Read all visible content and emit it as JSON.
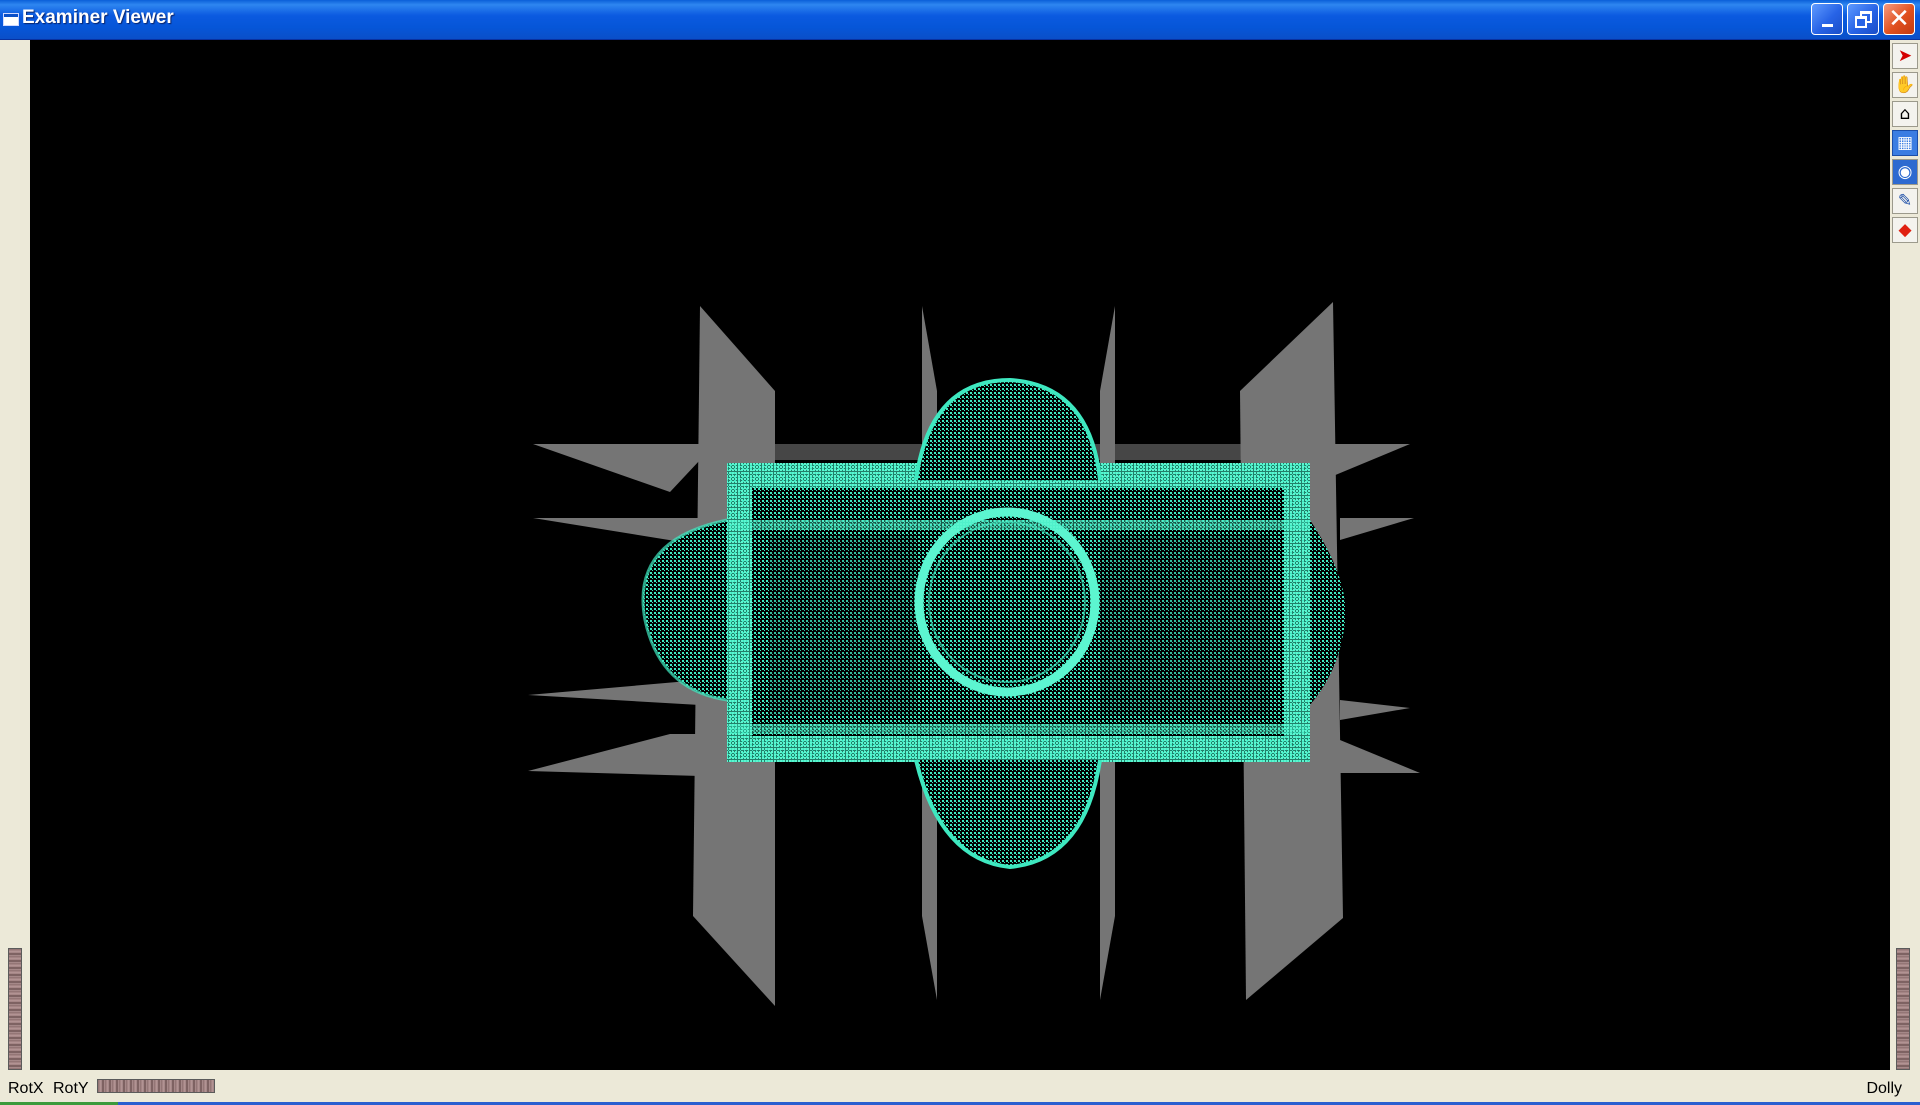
{
  "window": {
    "title": "Examiner Viewer"
  },
  "title_controls": {
    "minimize_icon": "minimize-icon",
    "restore_icon": "restore-icon",
    "close_icon": "close-icon",
    "close_color": "#e0501e",
    "button_color": "#2763e6"
  },
  "viewport": {
    "background": "#000000",
    "point_color": "#3ee8c0",
    "plane_color": "#7f7f7f"
  },
  "toolbar": {
    "items": [
      {
        "icon": "pick-arrow-icon"
      },
      {
        "icon": "hand-icon"
      },
      {
        "icon": "home-icon"
      },
      {
        "icon": "set-home-icon"
      },
      {
        "icon": "view-all-icon"
      },
      {
        "icon": "seek-icon"
      },
      {
        "icon": "projection-icon"
      }
    ]
  },
  "bottom": {
    "rotx_label": "RotX",
    "roty_label": "RotY",
    "dolly_label": "Dolly"
  }
}
